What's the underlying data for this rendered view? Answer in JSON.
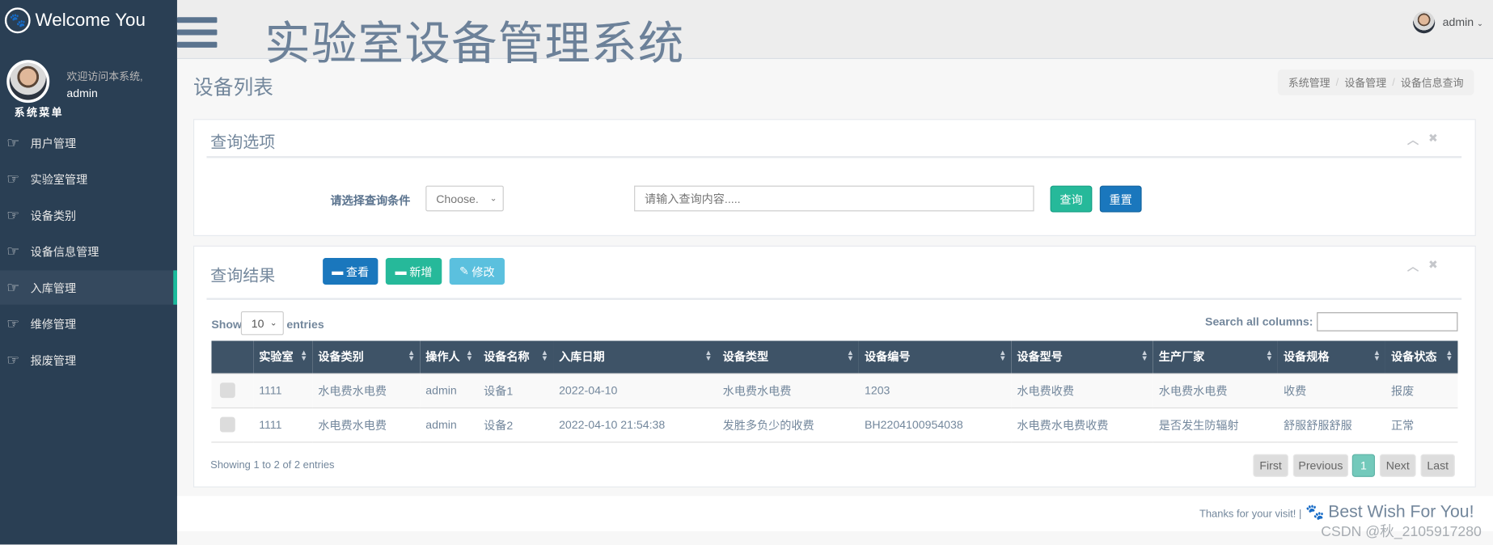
{
  "sidebar": {
    "brand": "Welcome You",
    "welcome": "欢迎访问本系统,",
    "username": "admin",
    "menu_title": "系统菜单",
    "items": [
      {
        "label": "用户管理",
        "active": false
      },
      {
        "label": "实验室管理",
        "active": false
      },
      {
        "label": "设备类别",
        "active": false
      },
      {
        "label": "设备信息管理",
        "active": false
      },
      {
        "label": "入库管理",
        "active": true
      },
      {
        "label": "维修管理",
        "active": false
      },
      {
        "label": "报废管理",
        "active": false
      }
    ]
  },
  "header": {
    "title": "实验室设备管理系统",
    "user": "admin"
  },
  "page": {
    "title": "设备列表",
    "breadcrumb": [
      "系统管理",
      "设备管理",
      "设备信息查询"
    ]
  },
  "query": {
    "title": "查询选项",
    "label": "请选择查询条件",
    "select_value": "Choose.",
    "input_placeholder": "请输入查询内容.....",
    "search_label": "查询",
    "reset_label": "重置"
  },
  "results": {
    "title": "查询结果",
    "view_label": "查看",
    "add_label": "新增",
    "edit_label": "修改",
    "show": "Show",
    "entries": "entries",
    "page_size": "10",
    "search_label": "Search all columns:",
    "columns": [
      "实验室",
      "设备类别",
      "操作人",
      "设备名称",
      "入库日期",
      "设备类型",
      "设备编号",
      "设备型号",
      "生产厂家",
      "设备规格",
      "设备状态"
    ],
    "rows": [
      [
        "1111",
        "水电费水电费",
        "admin",
        "设备1",
        "2022-04-10",
        "水电费水电费",
        "1203",
        "水电费收费",
        "水电费水电费",
        "收费",
        "报废"
      ],
      [
        "1111",
        "水电费水电费",
        "admin",
        "设备2",
        "2022-04-10 21:54:38",
        "发胜多负少的收费",
        "BH2204100954038",
        "水电费水电费收费",
        "是否发生防辐射",
        "舒服舒服舒服",
        "正常"
      ]
    ],
    "info": "Showing 1 to 2 of 2 entries",
    "pagination": {
      "first": "First",
      "previous": "Previous",
      "current": "1",
      "next": "Next",
      "last": "Last"
    }
  },
  "footer": {
    "thanks": "Thanks for your visit! |",
    "wish": "Best Wish For You!",
    "watermark": "CSDN @秋_2105917280"
  },
  "colors": {
    "sidebar": "#2a3f54",
    "teal": "#26b99a",
    "blue": "#1a77bd",
    "info": "#5bc0de",
    "table_header": "#3e5367"
  }
}
